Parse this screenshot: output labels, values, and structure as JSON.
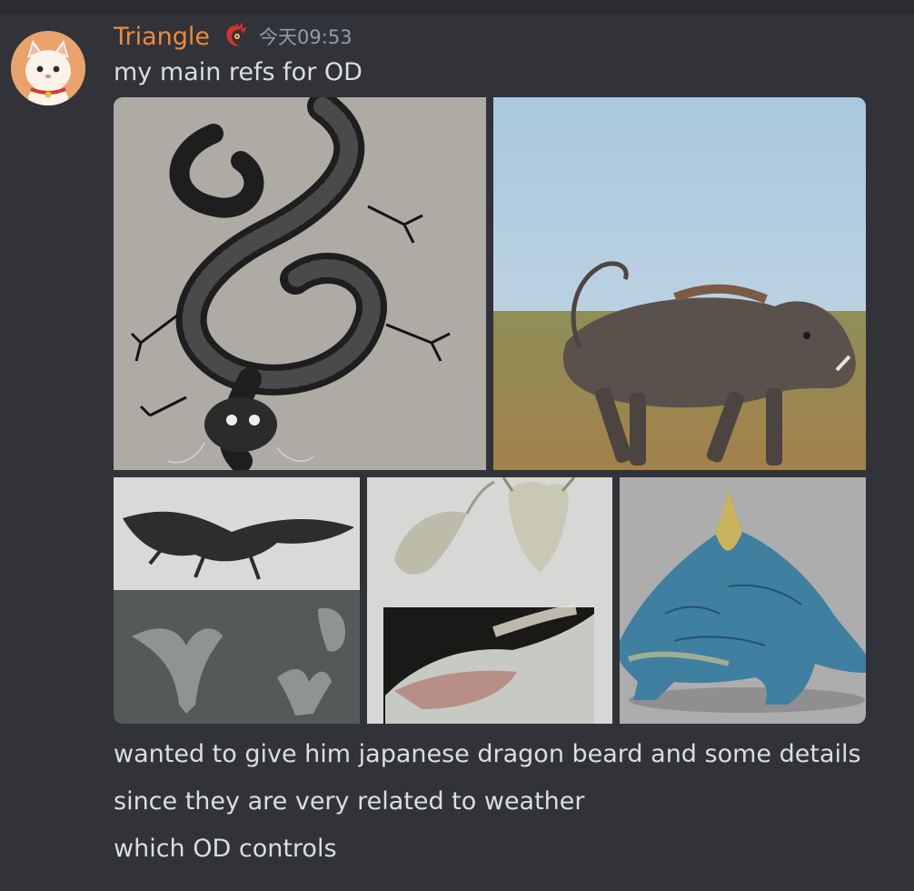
{
  "message": {
    "author": "Triangle",
    "author_color": "#f0883e",
    "role_icon": "red-dragon-badge-icon",
    "timestamp": "今天09:53",
    "lines_before": [
      "my main refs for OD"
    ],
    "attachments": [
      {
        "subject": "black ink japanese dragon illustration"
      },
      {
        "subject": "warthog walking in grass"
      },
      {
        "subject": "winged dragon 3d model sheet"
      },
      {
        "subject": "white bearded dragon head concept"
      },
      {
        "subject": "blue spined beast concept"
      }
    ],
    "lines_after": [
      "wanted to give him japanese dragon beard and some details",
      "since they are very related to weather",
      "which OD controls"
    ]
  }
}
